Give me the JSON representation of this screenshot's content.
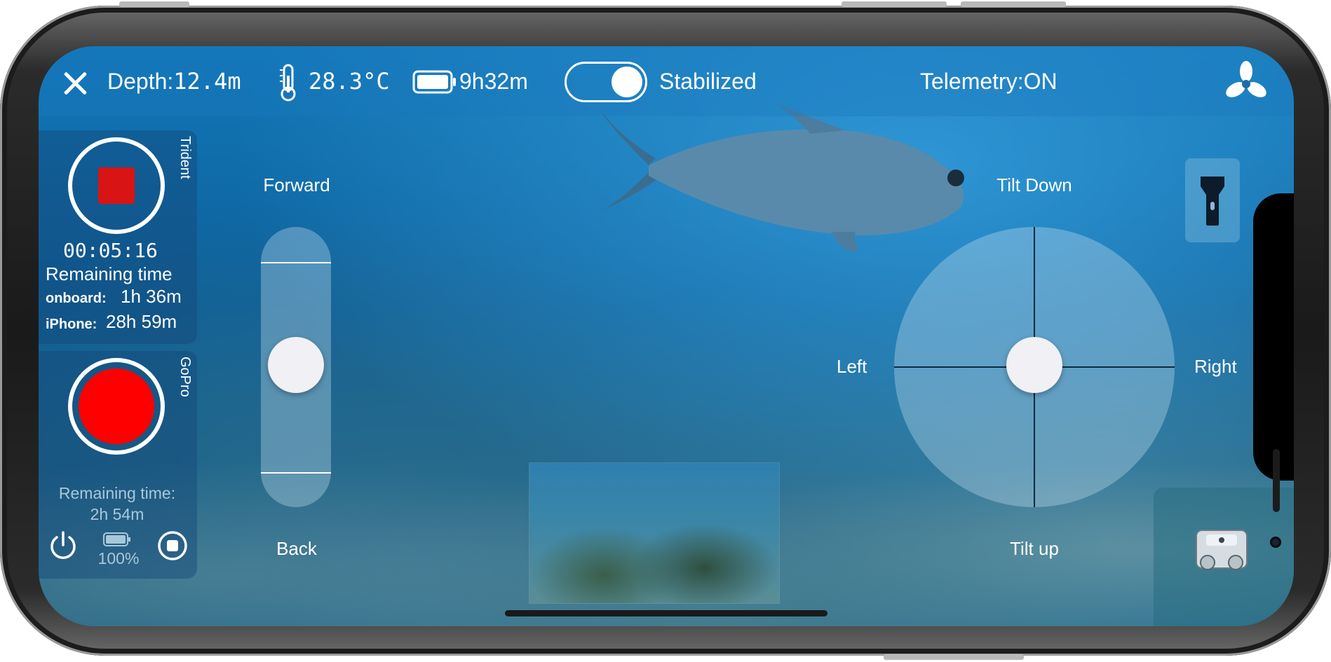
{
  "topbar": {
    "depth_label": "Depth:",
    "depth_value": "12.4m",
    "temperature": "28.3°C",
    "battery_time": "9h32m",
    "stabilized_label": "Stabilized",
    "stabilized_on": true,
    "telemetry": "Telemetry:ON",
    "icons": [
      "close-icon",
      "thermometer-icon",
      "battery-icon",
      "propeller-icon"
    ]
  },
  "trident": {
    "label": "Trident",
    "timer": "00:05:16",
    "remaining_label": "Remaining time",
    "onboard_label": "onboard:",
    "onboard_value": "1h 36m",
    "iphone_label": "iPhone:",
    "iphone_value": "28h 59m"
  },
  "gopro": {
    "label": "GoPro",
    "remaining_label": "Remaining time:",
    "remaining_value": "2h 54m",
    "battery_percent": "100%"
  },
  "controls": {
    "forward": "Forward",
    "back": "Back",
    "tilt_down": "Tilt Down",
    "tilt_up": "Tilt up",
    "left": "Left",
    "right": "Right"
  },
  "colors": {
    "record_red": "#ff0000",
    "stop_red": "#d81414",
    "panel_bg": "#14467880"
  }
}
